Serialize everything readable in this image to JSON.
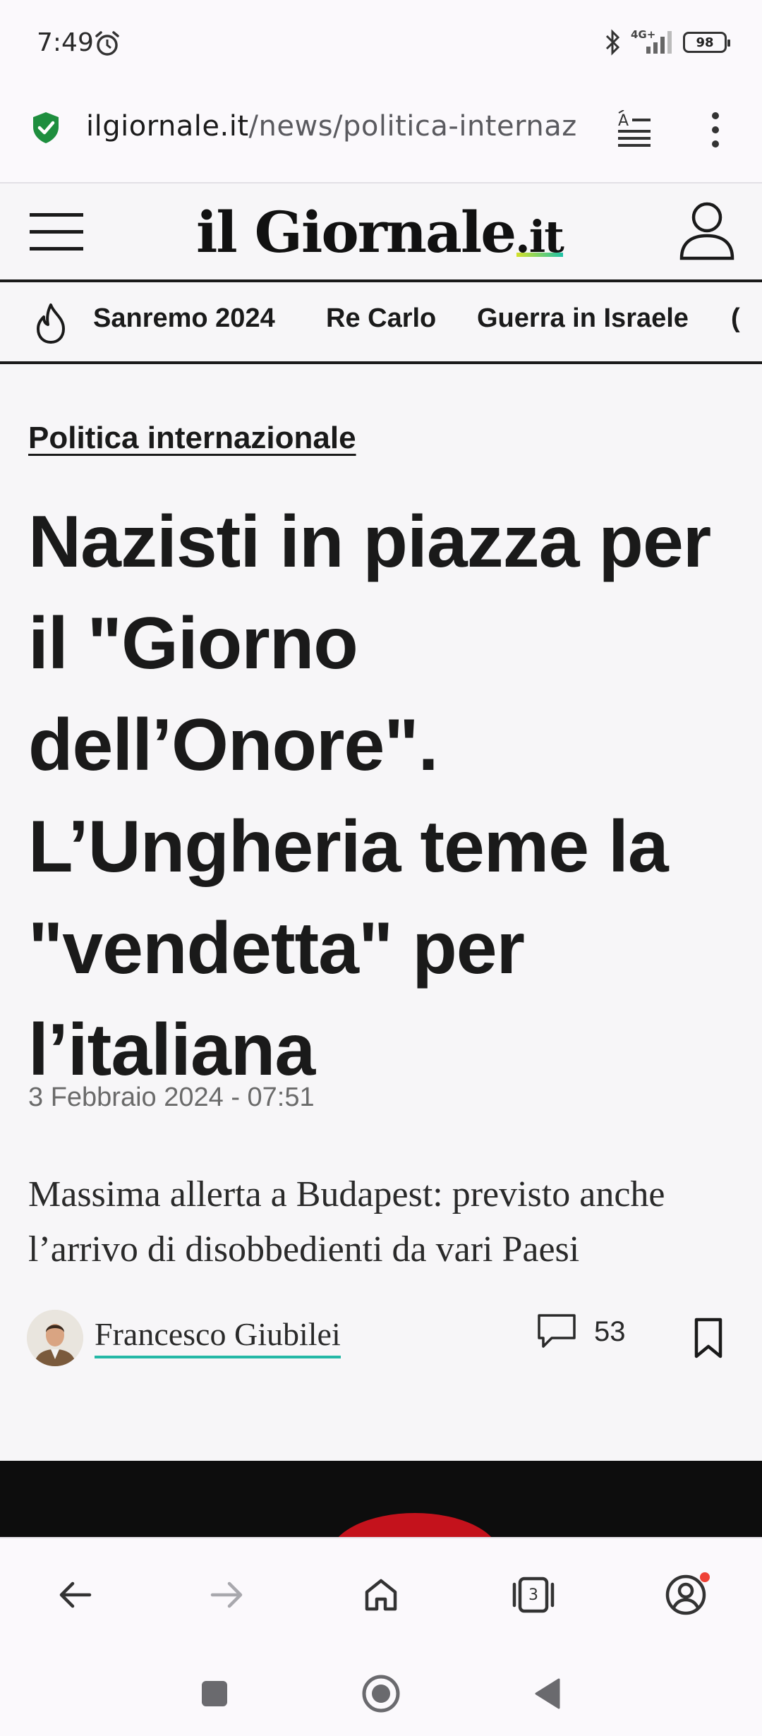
{
  "status_bar": {
    "time": "7:49",
    "network": "4G+",
    "battery": "98",
    "icons": [
      "alarm-icon",
      "bluetooth-icon",
      "signal-icon",
      "battery-icon"
    ]
  },
  "browser": {
    "url_host": "ilgiornale.it",
    "url_path": "/news/politica-internaz",
    "tab_count": "3",
    "colors": {
      "secure_shield": "#1e8e3e",
      "notification_dot": "#ef4136"
    }
  },
  "site": {
    "logo_main": "il Giornale",
    "logo_suffix": ".it",
    "tags": [
      "Sanremo 2024",
      "Re Carlo",
      "Guerra in Israele"
    ]
  },
  "article": {
    "category": "Politica internazionale",
    "headline": "Nazisti in piazza per il \"Giorno dell’Onore\". L’Ungheria teme la \"vendetta\" per l’italiana",
    "date": "3 Febbraio 2024 - 07:51",
    "subtitle": "Massima allerta a Budapest: previsto anche l’arrivo di disobbedienti da vari Paesi",
    "author": "Francesco Giubilei",
    "comment_count": "53",
    "colors": {
      "author_underline": "#24b8a6",
      "logo_gradient_start": "#d4e02a",
      "logo_gradient_end": "#1fc2a7"
    }
  }
}
